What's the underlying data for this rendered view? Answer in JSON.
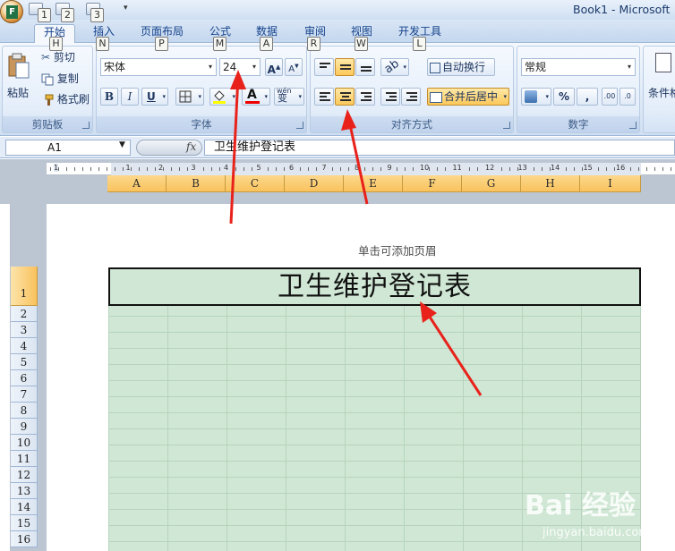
{
  "window": {
    "title": "Book1 - Microsoft",
    "quick_access_keytips": [
      "1",
      "2",
      "3"
    ]
  },
  "ribbon_tabs": [
    {
      "label": "开始",
      "keytip": "H",
      "active": true
    },
    {
      "label": "插入",
      "keytip": "N"
    },
    {
      "label": "页面布局",
      "keytip": "P"
    },
    {
      "label": "公式",
      "keytip": "M"
    },
    {
      "label": "数据",
      "keytip": "A"
    },
    {
      "label": "审阅",
      "keytip": "R"
    },
    {
      "label": "视图",
      "keytip": "W"
    },
    {
      "label": "开发工具",
      "keytip": "L"
    }
  ],
  "clipboard": {
    "label": "剪贴板",
    "paste": "粘贴",
    "cut": "剪切",
    "copy": "复制",
    "format_painter": "格式刷"
  },
  "font": {
    "label": "字体",
    "name": "宋体",
    "size": "24",
    "bold": "B",
    "italic": "I",
    "underline": "U",
    "font_color_letter": "A",
    "phonetic": "wén",
    "phonetic_char": "变"
  },
  "alignment": {
    "label": "对齐方式",
    "wrap_text": "自动换行",
    "merge_center": "合并后居中"
  },
  "number": {
    "label": "数字",
    "format": "常规",
    "percent": "%",
    "comma": ",",
    "inc_decimal": ".00",
    "dec_decimal": ".0"
  },
  "styles": {
    "conditional": "条件格"
  },
  "formula_bar": {
    "cell_ref": "A1",
    "fx": "fx",
    "content": "卫生维护登记表"
  },
  "ruler": [
    "1",
    "1",
    "2",
    "3",
    "4",
    "5",
    "6",
    "7",
    "8",
    "9",
    "10",
    "11",
    "12",
    "13",
    "14",
    "15",
    "16"
  ],
  "columns": [
    "A",
    "B",
    "C",
    "D",
    "E",
    "F",
    "G",
    "H",
    "I"
  ],
  "header_hint": "单击可添加页眉",
  "rows": [
    "1",
    "2",
    "3",
    "4",
    "5",
    "6",
    "7",
    "8",
    "9",
    "10",
    "11",
    "12",
    "13",
    "14",
    "15",
    "16"
  ],
  "merged_cell": {
    "text": "卫生维护登记表"
  },
  "watermark": {
    "text": "Bai 经验",
    "url": "jingyan.baidu.com"
  },
  "colors": {
    "accent": "#f9c25d",
    "grid": "#cfe7d4",
    "arrow": "#e8221b"
  }
}
